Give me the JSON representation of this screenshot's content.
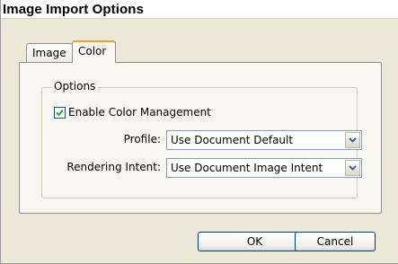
{
  "window": {
    "title": "Image Import Options"
  },
  "tabs": [
    {
      "label": "Image",
      "selected": false
    },
    {
      "label": "Color",
      "selected": true
    }
  ],
  "options_group": {
    "legend": "Options",
    "enable_color_management": {
      "label": "Enable Color Management",
      "checked": true
    },
    "profile": {
      "label": "Profile:",
      "value": "Use Document Default"
    },
    "rendering_intent": {
      "label": "Rendering Intent:",
      "value": "Use Document Image Intent"
    }
  },
  "buttons": {
    "ok": "OK",
    "cancel": "Cancel"
  },
  "colors": {
    "dialog_bg": "#ece9d8",
    "tab_accent": "#e9a13b",
    "checkbox_border": "#1c5180"
  }
}
